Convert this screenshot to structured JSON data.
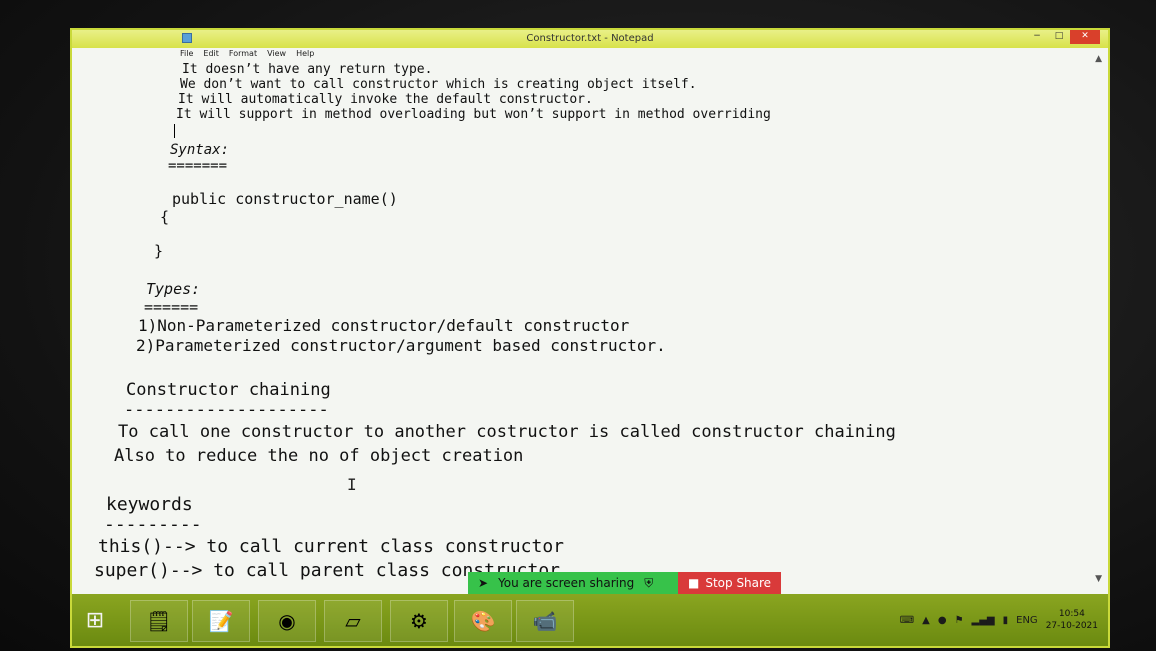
{
  "window": {
    "title": "Constructor.txt - Notepad",
    "min": "−",
    "max": "□",
    "close": "✕"
  },
  "menu": [
    "File",
    "Edit",
    "Format",
    "View",
    "Help"
  ],
  "editor": {
    "lines": [
      "It doesn’t have any return type.",
      "We don’t want to call constructor which is creating object itself.",
      "It will automatically invoke the default constructor.",
      "It will support in method overloading but won’t support in method overriding",
      "Syntax:",
      "=======",
      "public constructor_name()",
      "{",
      "}",
      "Types:",
      "======",
      "1)Non-Parameterized constructor/default constructor",
      "2)Parameterized constructor/argument based constructor.",
      "Constructor chaining",
      "--------------------",
      "To call one constructor to another costructor is called constructor chaining",
      "Also to reduce the no of object creation",
      "keywords",
      "---------",
      "this()--> to call current class constructor",
      "super()--> to call parent class constructor"
    ]
  },
  "share": {
    "status": "You are screen sharing",
    "stop": "Stop Share"
  },
  "taskbar": {
    "apps": [
      "notepad-app",
      "calculator-app",
      "chrome-app",
      "files-app",
      "java-ee-ide-app",
      "paint-app",
      "zoom-app"
    ],
    "language": "ENG",
    "time": "10:54",
    "date": "27-10-2021"
  }
}
